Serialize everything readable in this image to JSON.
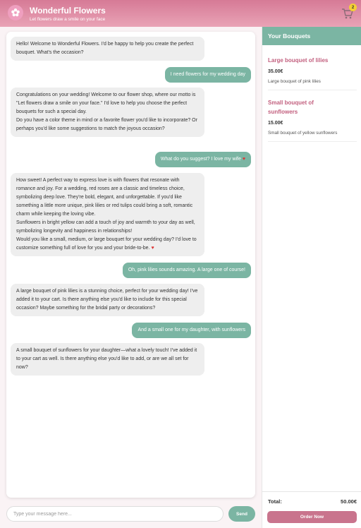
{
  "header": {
    "title": "Wonderful Flowers",
    "subtitle": "Let flowers draw a smile on your face",
    "cart_count": "2",
    "colors": {
      "brand_pink": "#d67a96",
      "accent_green": "#7bb5a3",
      "badge_yellow": "#f4cf36"
    }
  },
  "chat": {
    "messages": [
      {
        "from": "bot",
        "text": "Hello! Welcome to Wonderful Flowers. I'd be happy to help you create the perfect bouquet. What's the occasion?"
      },
      {
        "from": "user",
        "text": "I need flowers for my wedding day"
      },
      {
        "from": "bot",
        "text": "Congratulations on your wedding! Welcome to our flower shop, where our motto is \"Let flowers draw a smile on your face.\" I'd love to help you choose the perfect bouquets for such a special day.\nDo you have a color theme in mind or a favorite flower you'd like to incorporate? Or perhaps you'd like some suggestions to match the joyous occasion?"
      },
      {
        "from": "user",
        "text": "What do you suggest? I love my wife"
      },
      {
        "from": "bot",
        "text": "How sweet! A perfect way to express love is with flowers that resonate with romance and joy. For a wedding, red roses are a classic and timeless choice, symbolizing deep love. They're bold, elegant, and unforgettable. If you'd like something a little more unique, pink lilies or red tulips could bring a soft, romantic charm while keeping the loving vibe.\nSunflowers in bright yellow can add a touch of joy and warmth to your day as well, symbolizing longevity and happiness in relationships!\nWould you like a small, medium, or large bouquet for your wedding day? I'd love to customize something full of love for you and your bride-to-be."
      },
      {
        "from": "user",
        "text": "Oh, pink lilies sounds amazing. A large one of course!"
      },
      {
        "from": "bot",
        "text": "A large bouquet of pink lilies is a stunning choice, perfect for your wedding day! I've added it to your cart. Is there anything else you'd like to include for this special occasion? Maybe something for the bridal party or decorations?"
      },
      {
        "from": "user",
        "text": "And a small one for my daughter, with sunflowers"
      },
      {
        "from": "bot",
        "text": "A small bouquet of sunflowers for your daughter—what a lovely touch! I've added it to your cart as well. Is there anything else you'd like to add, or are we all set for now?"
      }
    ],
    "heart_icon": "heart-icon",
    "input_placeholder": "Type your message here...",
    "input_value": "",
    "send_label": "Send"
  },
  "sidebar": {
    "title": "Your Bouquets",
    "items": [
      {
        "name": "Large bouquet of lilies",
        "price": "35.00€",
        "description": "Large bouquet of pink lilies"
      },
      {
        "name": "Small bouquet of sunflowers",
        "price": "15.00€",
        "description": "Small bouquet of yellow sunflowers"
      }
    ],
    "total_label": "Total:",
    "total_value": "50.00€",
    "order_label": "Order Now"
  }
}
